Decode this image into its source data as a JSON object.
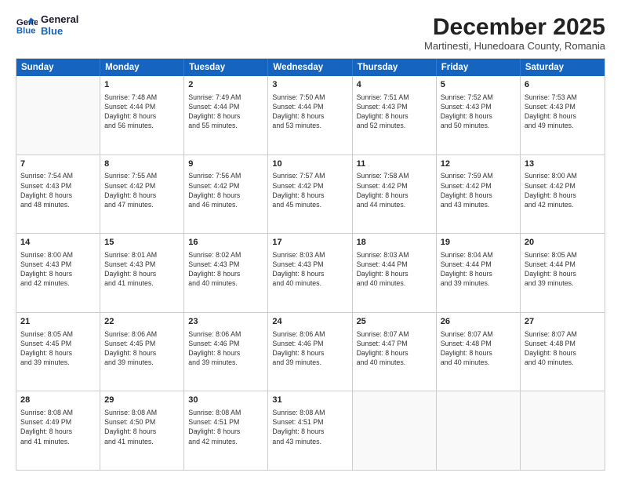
{
  "logo": {
    "line1": "General",
    "line2": "Blue"
  },
  "title": "December 2025",
  "location": "Martinesti, Hunedoara County, Romania",
  "days_header": [
    "Sunday",
    "Monday",
    "Tuesday",
    "Wednesday",
    "Thursday",
    "Friday",
    "Saturday"
  ],
  "weeks": [
    [
      {
        "day": "",
        "info": ""
      },
      {
        "day": "1",
        "info": "Sunrise: 7:48 AM\nSunset: 4:44 PM\nDaylight: 8 hours\nand 56 minutes."
      },
      {
        "day": "2",
        "info": "Sunrise: 7:49 AM\nSunset: 4:44 PM\nDaylight: 8 hours\nand 55 minutes."
      },
      {
        "day": "3",
        "info": "Sunrise: 7:50 AM\nSunset: 4:44 PM\nDaylight: 8 hours\nand 53 minutes."
      },
      {
        "day": "4",
        "info": "Sunrise: 7:51 AM\nSunset: 4:43 PM\nDaylight: 8 hours\nand 52 minutes."
      },
      {
        "day": "5",
        "info": "Sunrise: 7:52 AM\nSunset: 4:43 PM\nDaylight: 8 hours\nand 50 minutes."
      },
      {
        "day": "6",
        "info": "Sunrise: 7:53 AM\nSunset: 4:43 PM\nDaylight: 8 hours\nand 49 minutes."
      }
    ],
    [
      {
        "day": "7",
        "info": "Sunrise: 7:54 AM\nSunset: 4:43 PM\nDaylight: 8 hours\nand 48 minutes."
      },
      {
        "day": "8",
        "info": "Sunrise: 7:55 AM\nSunset: 4:42 PM\nDaylight: 8 hours\nand 47 minutes."
      },
      {
        "day": "9",
        "info": "Sunrise: 7:56 AM\nSunset: 4:42 PM\nDaylight: 8 hours\nand 46 minutes."
      },
      {
        "day": "10",
        "info": "Sunrise: 7:57 AM\nSunset: 4:42 PM\nDaylight: 8 hours\nand 45 minutes."
      },
      {
        "day": "11",
        "info": "Sunrise: 7:58 AM\nSunset: 4:42 PM\nDaylight: 8 hours\nand 44 minutes."
      },
      {
        "day": "12",
        "info": "Sunrise: 7:59 AM\nSunset: 4:42 PM\nDaylight: 8 hours\nand 43 minutes."
      },
      {
        "day": "13",
        "info": "Sunrise: 8:00 AM\nSunset: 4:42 PM\nDaylight: 8 hours\nand 42 minutes."
      }
    ],
    [
      {
        "day": "14",
        "info": "Sunrise: 8:00 AM\nSunset: 4:43 PM\nDaylight: 8 hours\nand 42 minutes."
      },
      {
        "day": "15",
        "info": "Sunrise: 8:01 AM\nSunset: 4:43 PM\nDaylight: 8 hours\nand 41 minutes."
      },
      {
        "day": "16",
        "info": "Sunrise: 8:02 AM\nSunset: 4:43 PM\nDaylight: 8 hours\nand 40 minutes."
      },
      {
        "day": "17",
        "info": "Sunrise: 8:03 AM\nSunset: 4:43 PM\nDaylight: 8 hours\nand 40 minutes."
      },
      {
        "day": "18",
        "info": "Sunrise: 8:03 AM\nSunset: 4:44 PM\nDaylight: 8 hours\nand 40 minutes."
      },
      {
        "day": "19",
        "info": "Sunrise: 8:04 AM\nSunset: 4:44 PM\nDaylight: 8 hours\nand 39 minutes."
      },
      {
        "day": "20",
        "info": "Sunrise: 8:05 AM\nSunset: 4:44 PM\nDaylight: 8 hours\nand 39 minutes."
      }
    ],
    [
      {
        "day": "21",
        "info": "Sunrise: 8:05 AM\nSunset: 4:45 PM\nDaylight: 8 hours\nand 39 minutes."
      },
      {
        "day": "22",
        "info": "Sunrise: 8:06 AM\nSunset: 4:45 PM\nDaylight: 8 hours\nand 39 minutes."
      },
      {
        "day": "23",
        "info": "Sunrise: 8:06 AM\nSunset: 4:46 PM\nDaylight: 8 hours\nand 39 minutes."
      },
      {
        "day": "24",
        "info": "Sunrise: 8:06 AM\nSunset: 4:46 PM\nDaylight: 8 hours\nand 39 minutes."
      },
      {
        "day": "25",
        "info": "Sunrise: 8:07 AM\nSunset: 4:47 PM\nDaylight: 8 hours\nand 40 minutes."
      },
      {
        "day": "26",
        "info": "Sunrise: 8:07 AM\nSunset: 4:48 PM\nDaylight: 8 hours\nand 40 minutes."
      },
      {
        "day": "27",
        "info": "Sunrise: 8:07 AM\nSunset: 4:48 PM\nDaylight: 8 hours\nand 40 minutes."
      }
    ],
    [
      {
        "day": "28",
        "info": "Sunrise: 8:08 AM\nSunset: 4:49 PM\nDaylight: 8 hours\nand 41 minutes."
      },
      {
        "day": "29",
        "info": "Sunrise: 8:08 AM\nSunset: 4:50 PM\nDaylight: 8 hours\nand 41 minutes."
      },
      {
        "day": "30",
        "info": "Sunrise: 8:08 AM\nSunset: 4:51 PM\nDaylight: 8 hours\nand 42 minutes."
      },
      {
        "day": "31",
        "info": "Sunrise: 8:08 AM\nSunset: 4:51 PM\nDaylight: 8 hours\nand 43 minutes."
      },
      {
        "day": "",
        "info": ""
      },
      {
        "day": "",
        "info": ""
      },
      {
        "day": "",
        "info": ""
      }
    ]
  ]
}
